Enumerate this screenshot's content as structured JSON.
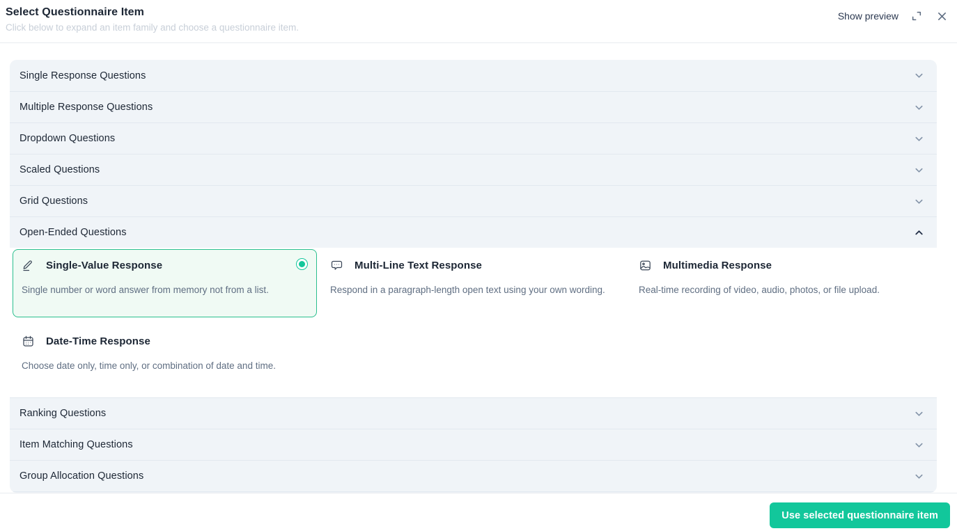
{
  "header": {
    "title": "Select Questionnaire Item",
    "subtitle": "Click below to expand an item family and choose a questionnaire item.",
    "show_preview_label": "Show preview"
  },
  "accordion": {
    "sections": [
      {
        "label": "Single Response Questions",
        "expanded": false
      },
      {
        "label": "Multiple Response Questions",
        "expanded": false
      },
      {
        "label": "Dropdown Questions",
        "expanded": false
      },
      {
        "label": "Scaled Questions",
        "expanded": false
      },
      {
        "label": "Grid Questions",
        "expanded": false
      },
      {
        "label": "Open-Ended Questions",
        "expanded": true
      },
      {
        "label": "Ranking Questions",
        "expanded": false
      },
      {
        "label": "Item Matching Questions",
        "expanded": false
      },
      {
        "label": "Group Allocation Questions",
        "expanded": false
      }
    ]
  },
  "open_ended_items": [
    {
      "title": "Single-Value Response",
      "description": "Single number or word answer from memory not from a list.",
      "icon": "pencil-icon",
      "selected": true
    },
    {
      "title": "Multi-Line Text Response",
      "description": "Respond in a paragraph-length open text using your own wording.",
      "icon": "chat-bubble-icon",
      "selected": false
    },
    {
      "title": "Multimedia Response",
      "description": "Real-time recording of video, audio, photos, or file upload.",
      "icon": "image-icon",
      "selected": false
    },
    {
      "title": "Date-Time Response",
      "description": "Choose date only, time only, or combination of date and time.",
      "icon": "calendar-icon",
      "selected": false
    }
  ],
  "footer": {
    "submit_label": "Use selected questionnaire item"
  },
  "colors": {
    "accent_green": "#12c79b",
    "selected_card_border": "#2abf8e",
    "selected_card_bg": "#f0faf4",
    "section_bg": "#f0f4f8"
  }
}
